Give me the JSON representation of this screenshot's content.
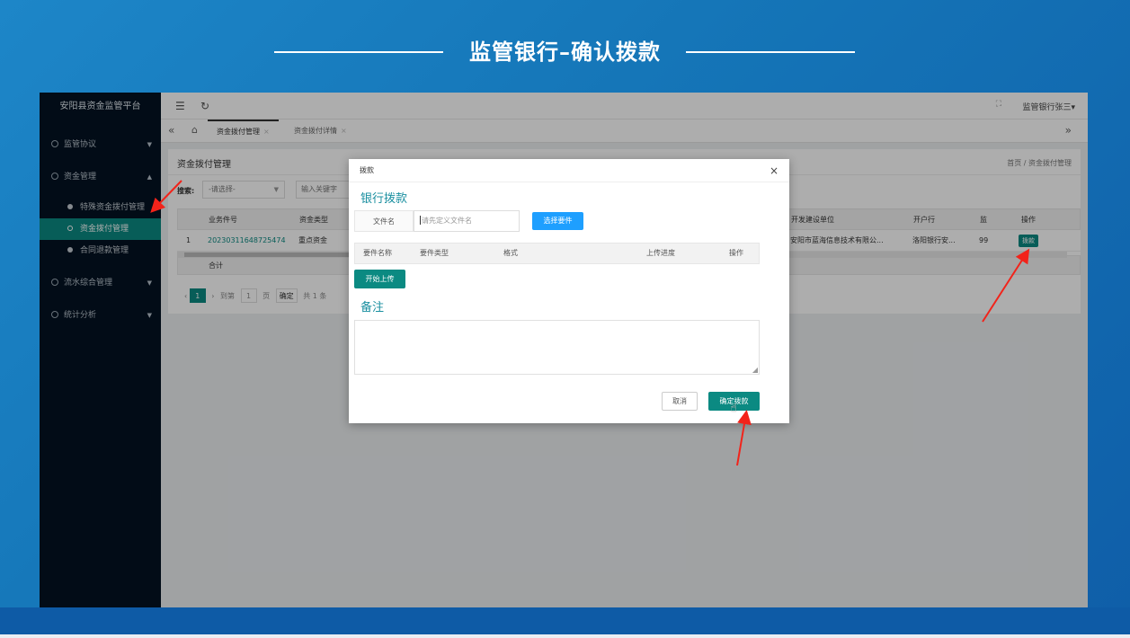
{
  "slide": {
    "title": "监管银行–确认拨款"
  },
  "app": {
    "brand": "安阳县资金监管平台",
    "topbar": {
      "user": "监管银行张三▾",
      "refresh_icon": "↻",
      "menu_icon": "☰"
    },
    "sidebar": {
      "groups": [
        {
          "label": "监管协议",
          "arrow": "▼"
        },
        {
          "label": "资金管理",
          "arrow": "▲"
        },
        {
          "label": "流水综合管理",
          "arrow": "▼"
        },
        {
          "label": "统计分析",
          "arrow": "▼"
        }
      ],
      "sub_items": [
        {
          "label": "特殊资金拨付管理"
        },
        {
          "label": "资金拨付管理"
        },
        {
          "label": "合同退款管理"
        }
      ]
    },
    "tabs": [
      {
        "label": "资金拨付管理",
        "close": "×"
      },
      {
        "label": "资金拨付详情",
        "close": "×"
      }
    ],
    "panel": {
      "title": "资金拨付管理",
      "breadcrumb": "首页 / 资金拨付管理",
      "search_label": "搜索:",
      "select_value": "-请选择-",
      "keyword_placeholder": "输入关键字",
      "columns": [
        "业务件号",
        "资金类型",
        "开发建设单位",
        "开户行",
        "监",
        "操作"
      ],
      "row": {
        "index": "1",
        "case_no": "20230311648725474",
        "fund_type": "重点资金",
        "developer": "安阳市蓝海信息技术有限公...",
        "bank": "洛阳银行安...",
        "supervise": "99",
        "action": "拨款"
      },
      "total_label": "合计",
      "pager": {
        "page": "1",
        "goto": "到第",
        "page_input": "1",
        "page_unit": "页",
        "confirm": "确定",
        "total": "共 1 条"
      }
    },
    "modal": {
      "title": "拨款",
      "close": "×",
      "section_bank": "银行拨款",
      "file_name_label": "文件名",
      "file_name_placeholder": "请先定义文件名",
      "choose_button": "选择要件",
      "upload_columns": [
        "要件名称",
        "要件类型",
        "格式",
        "上传进度",
        "操作"
      ],
      "start_upload": "开始上传",
      "section_remark": "备注",
      "cancel": "取消",
      "confirm": "确定拨款"
    }
  }
}
